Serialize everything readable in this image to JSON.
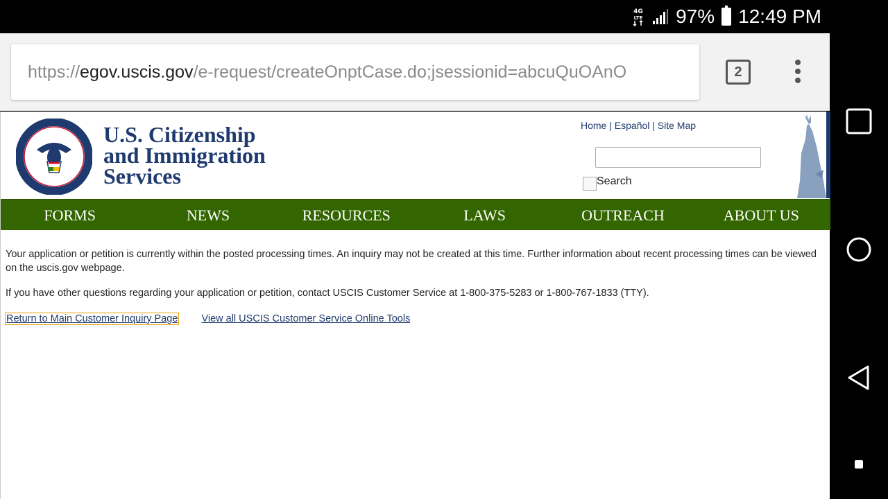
{
  "status_bar": {
    "network": "4G LTE",
    "battery_percent": "97%",
    "time": "12:49 PM"
  },
  "browser": {
    "url_scheme": "https://",
    "url_host": "egov.uscis.gov",
    "url_path": "/e-request/createOnptCase.do;jsessionid=abcuQuOAnO",
    "tab_count": "2"
  },
  "header": {
    "brand_line1": "U.S. Citizenship",
    "brand_line2": "and Immigration",
    "brand_line3": "Services",
    "top_links": [
      "Home",
      "Español",
      "Site Map"
    ],
    "search_value": "",
    "search_button_alt": "Search"
  },
  "nav": {
    "items": [
      "FORMS",
      "NEWS",
      "RESOURCES",
      "LAWS",
      "OUTREACH",
      "ABOUT US"
    ]
  },
  "content": {
    "message": "Your application or petition is currently within the posted processing times. An inquiry may not be created at this time. Further information about recent processing times can be viewed on the uscis.gov webpage.",
    "contact": "If you have other questions regarding your application or petition, contact USCIS Customer Service at 1-800-375-5283 or 1-800-767-1833 (TTY).",
    "link_return": "Return to Main Customer Inquiry Page",
    "link_all_tools": "View all USCIS Customer Service Online Tools"
  },
  "colors": {
    "nav_green": "#336600",
    "brand_blue": "#1e3a6e"
  }
}
